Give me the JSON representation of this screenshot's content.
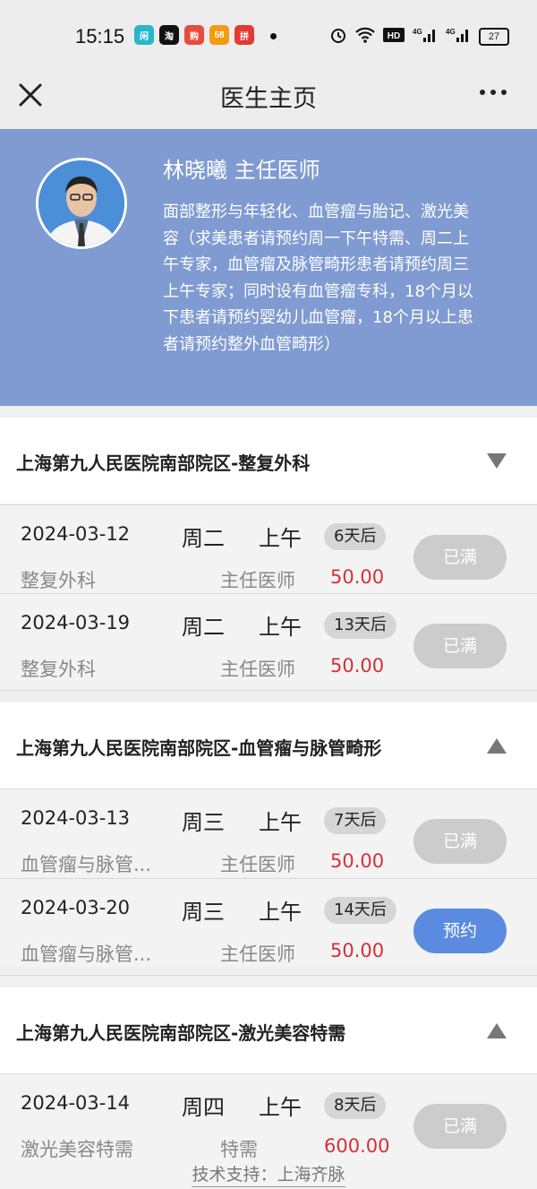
{
  "status_bar": {
    "time": "15:15",
    "app_icons": [
      "闲",
      "淘",
      "购",
      "58",
      "拼"
    ],
    "battery": "27",
    "network": "4G"
  },
  "nav": {
    "title": "医生主页"
  },
  "doctor": {
    "name": "林晓曦 主任医师",
    "description": "面部整形与年轻化、血管瘤与胎记、激光美容（求美患者请预约周一下午特需、周二上午专家，血管瘤及脉管畸形患者请预约周三上午专家；同时设有血管瘤专科，18个月以下患者请预约婴幼儿血管瘤，18个月以上患者请预约整外血管畸形）"
  },
  "sections": [
    {
      "title": "上海第九人民医院南部院区-整复外科",
      "expanded": false,
      "slots": [
        {
          "date": "2024-03-12",
          "weekday": "周二",
          "period": "上午",
          "days": "6天后",
          "dept": "整复外科",
          "title": "主任医师",
          "fee": "50.00",
          "button": "已满",
          "status": "full"
        },
        {
          "date": "2024-03-19",
          "weekday": "周二",
          "period": "上午",
          "days": "13天后",
          "dept": "整复外科",
          "title": "主任医师",
          "fee": "50.00",
          "button": "已满",
          "status": "full"
        }
      ]
    },
    {
      "title": "上海第九人民医院南部院区-血管瘤与脉管畸形",
      "expanded": true,
      "slots": [
        {
          "date": "2024-03-13",
          "weekday": "周三",
          "period": "上午",
          "days": "7天后",
          "dept": "血管瘤与脉管...",
          "title": "主任医师",
          "fee": "50.00",
          "button": "已满",
          "status": "full"
        },
        {
          "date": "2024-03-20",
          "weekday": "周三",
          "period": "上午",
          "days": "14天后",
          "dept": "血管瘤与脉管...",
          "title": "主任医师",
          "fee": "50.00",
          "button": "预约",
          "status": "available"
        }
      ]
    },
    {
      "title": "上海第九人民医院南部院区-激光美容特需",
      "expanded": true,
      "slots": [
        {
          "date": "2024-03-14",
          "weekday": "周四",
          "period": "上午",
          "days": "8天后",
          "dept": "激光美容特需",
          "title": "特需",
          "fee": "600.00",
          "button": "已满",
          "status": "full"
        }
      ]
    }
  ],
  "footer": {
    "text": "技术支持：上海齐脉"
  },
  "colors": {
    "profile_bg": "#7f9bd1",
    "fee": "#d6303a",
    "book_button": "#5b8be0",
    "full_button": "#cccccc"
  },
  "icons": {
    "close": "close-icon",
    "more": "more-icon",
    "collapsed": "chevron-down-icon",
    "expanded": "chevron-up-icon"
  }
}
